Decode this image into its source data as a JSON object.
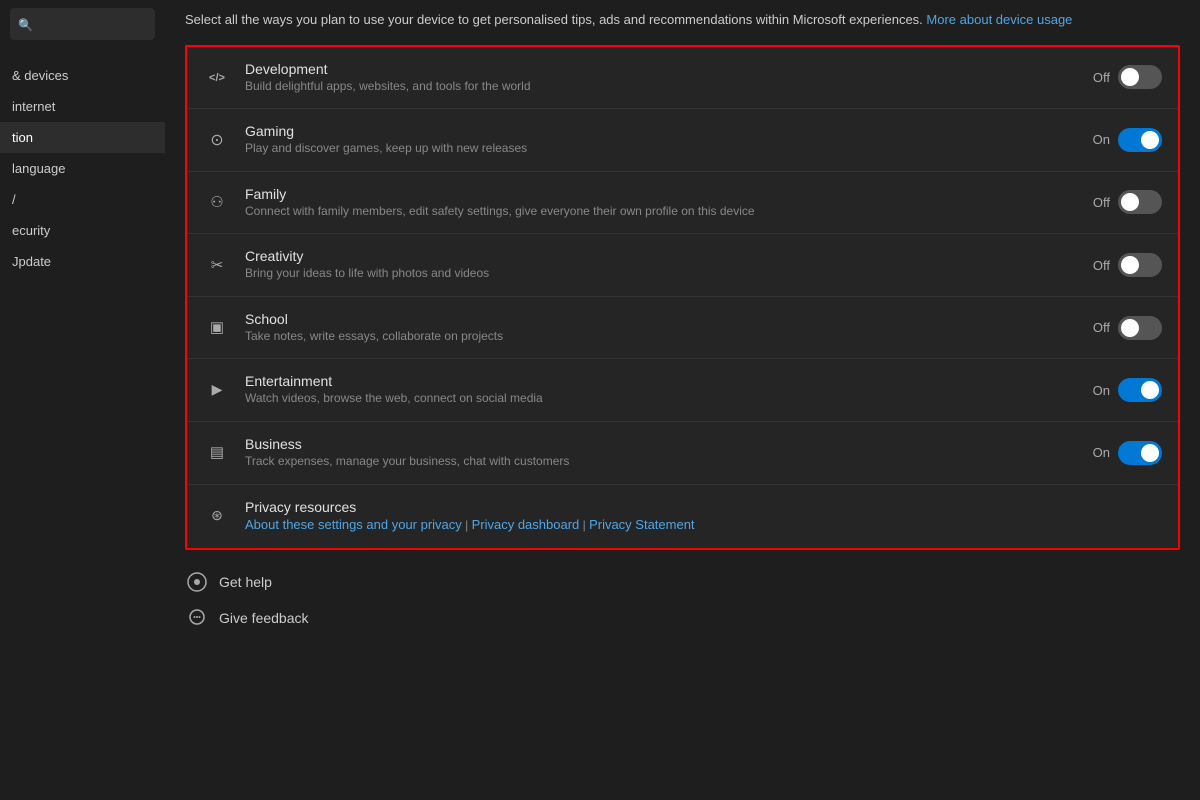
{
  "sidebar": {
    "search_placeholder": "Search",
    "items": [
      {
        "label": "& devices",
        "id": "devices",
        "active": false
      },
      {
        "label": "internet",
        "id": "internet",
        "active": false
      },
      {
        "label": "tion",
        "id": "tion",
        "active": true
      },
      {
        "label": "language",
        "id": "language",
        "active": false
      },
      {
        "label": "/ ",
        "id": "slash",
        "active": false
      },
      {
        "label": "ecurity",
        "id": "security",
        "active": false
      },
      {
        "label": "Jpdate",
        "id": "update",
        "active": false
      }
    ]
  },
  "intro": {
    "text": "Select all the ways you plan to use your device to get personalised tips, ads and recommendations within Microsoft experiences.",
    "link_text": "More about device usage"
  },
  "settings": [
    {
      "id": "development",
      "icon": "code",
      "title": "Development",
      "desc": "Build delightful apps, websites, and tools for the world",
      "state": "off",
      "label": "Off"
    },
    {
      "id": "gaming",
      "icon": "gaming",
      "title": "Gaming",
      "desc": "Play and discover games, keep up with new releases",
      "state": "on",
      "label": "On"
    },
    {
      "id": "family",
      "icon": "family",
      "title": "Family",
      "desc": "Connect with family members, edit safety settings, give everyone their own profile on this device",
      "state": "off",
      "label": "Off"
    },
    {
      "id": "creativity",
      "icon": "creativity",
      "title": "Creativity",
      "desc": "Bring your ideas to life with photos and videos",
      "state": "off",
      "label": "Off"
    },
    {
      "id": "school",
      "icon": "school",
      "title": "School",
      "desc": "Take notes, write essays, collaborate on projects",
      "state": "off",
      "label": "Off"
    },
    {
      "id": "entertainment",
      "icon": "entertainment",
      "title": "Entertainment",
      "desc": "Watch videos, browse the web, connect on social media",
      "state": "on",
      "label": "On"
    },
    {
      "id": "business",
      "icon": "business",
      "title": "Business",
      "desc": "Track expenses, manage your business, chat with customers",
      "state": "on",
      "label": "On"
    }
  ],
  "privacy": {
    "title": "Privacy resources",
    "links": [
      {
        "label": "About these settings and your privacy",
        "url": "#"
      },
      {
        "label": "Privacy dashboard",
        "url": "#"
      },
      {
        "label": "Privacy Statement",
        "url": "#"
      }
    ],
    "separator": " | "
  },
  "footer": [
    {
      "id": "get-help",
      "label": "Get help",
      "icon": "help"
    },
    {
      "id": "give-feedback",
      "label": "Give feedback",
      "icon": "feedback"
    }
  ],
  "colors": {
    "toggle_on": "#0078d4",
    "toggle_off": "#555555",
    "accent_link": "#4da6e8",
    "selection_border": "#ff0000"
  }
}
